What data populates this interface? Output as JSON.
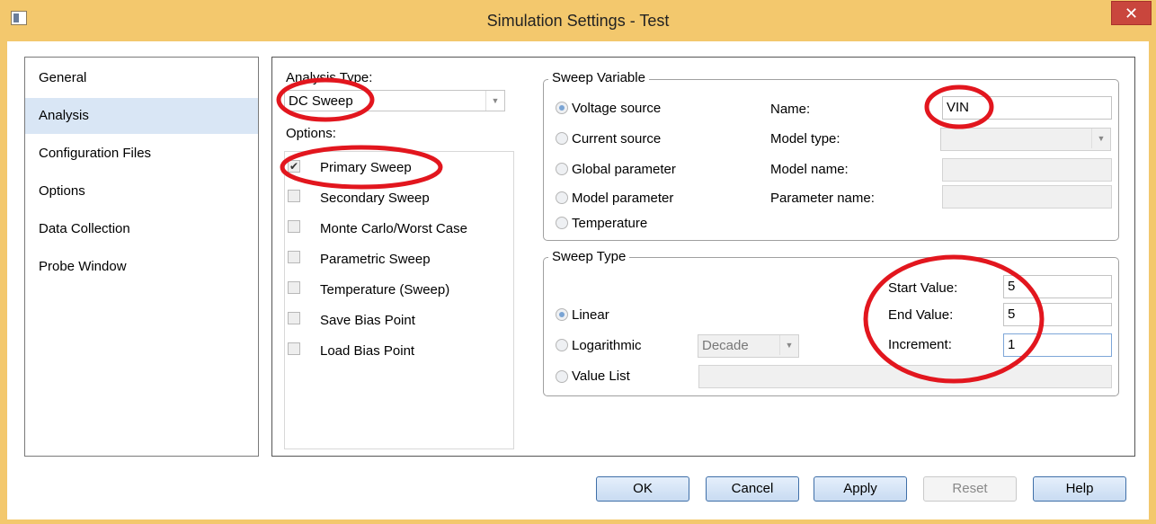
{
  "window": {
    "title": "Simulation Settings - Test",
    "close_glyph": "✕"
  },
  "nav": {
    "items": [
      {
        "label": "General"
      },
      {
        "label": "Analysis"
      },
      {
        "label": "Configuration Files"
      },
      {
        "label": "Options"
      },
      {
        "label": "Data Collection"
      },
      {
        "label": "Probe Window"
      }
    ],
    "selected": "Analysis"
  },
  "analysis": {
    "type_label": "Analysis Type:",
    "type_value": "DC Sweep",
    "options_label": "Options:",
    "options": [
      {
        "label": "Primary Sweep",
        "checked": true
      },
      {
        "label": "Secondary Sweep",
        "checked": false
      },
      {
        "label": "Monte Carlo/Worst Case",
        "checked": false
      },
      {
        "label": "Parametric Sweep",
        "checked": false
      },
      {
        "label": "Temperature (Sweep)",
        "checked": false
      },
      {
        "label": "Save Bias Point",
        "checked": false
      },
      {
        "label": "Load Bias Point",
        "checked": false
      }
    ]
  },
  "sweep_variable": {
    "group_label": "Sweep Variable",
    "radios": [
      {
        "label": "Voltage source",
        "selected": true
      },
      {
        "label": "Current source",
        "selected": false
      },
      {
        "label": "Global parameter",
        "selected": false
      },
      {
        "label": "Model parameter",
        "selected": false
      },
      {
        "label": "Temperature",
        "selected": false
      }
    ],
    "name_label": "Name:",
    "name_value": "VIN",
    "model_type_label": "Model type:",
    "model_type_value": "",
    "model_name_label": "Model name:",
    "model_name_value": "",
    "parameter_name_label": "Parameter name:",
    "parameter_name_value": ""
  },
  "sweep_type": {
    "group_label": "Sweep Type",
    "radios": [
      {
        "label": "Linear",
        "selected": true
      },
      {
        "label": "Logarithmic",
        "selected": false
      },
      {
        "label": "Value List",
        "selected": false
      }
    ],
    "log_scale_value": "Decade",
    "start_label": "Start Value:",
    "start_value": "5",
    "end_label": "End Value:",
    "end_value": "5",
    "increment_label": "Increment:",
    "increment_value": "1",
    "value_list_value": ""
  },
  "buttons": {
    "ok": "OK",
    "cancel": "Cancel",
    "apply": "Apply",
    "reset": "Reset",
    "help": "Help"
  },
  "colors": {
    "window_frame": "#f3c86d",
    "close_button": "#c9463d",
    "nav_selected": "#d9e6f5",
    "annotation_ellipse": "#e2161e"
  }
}
